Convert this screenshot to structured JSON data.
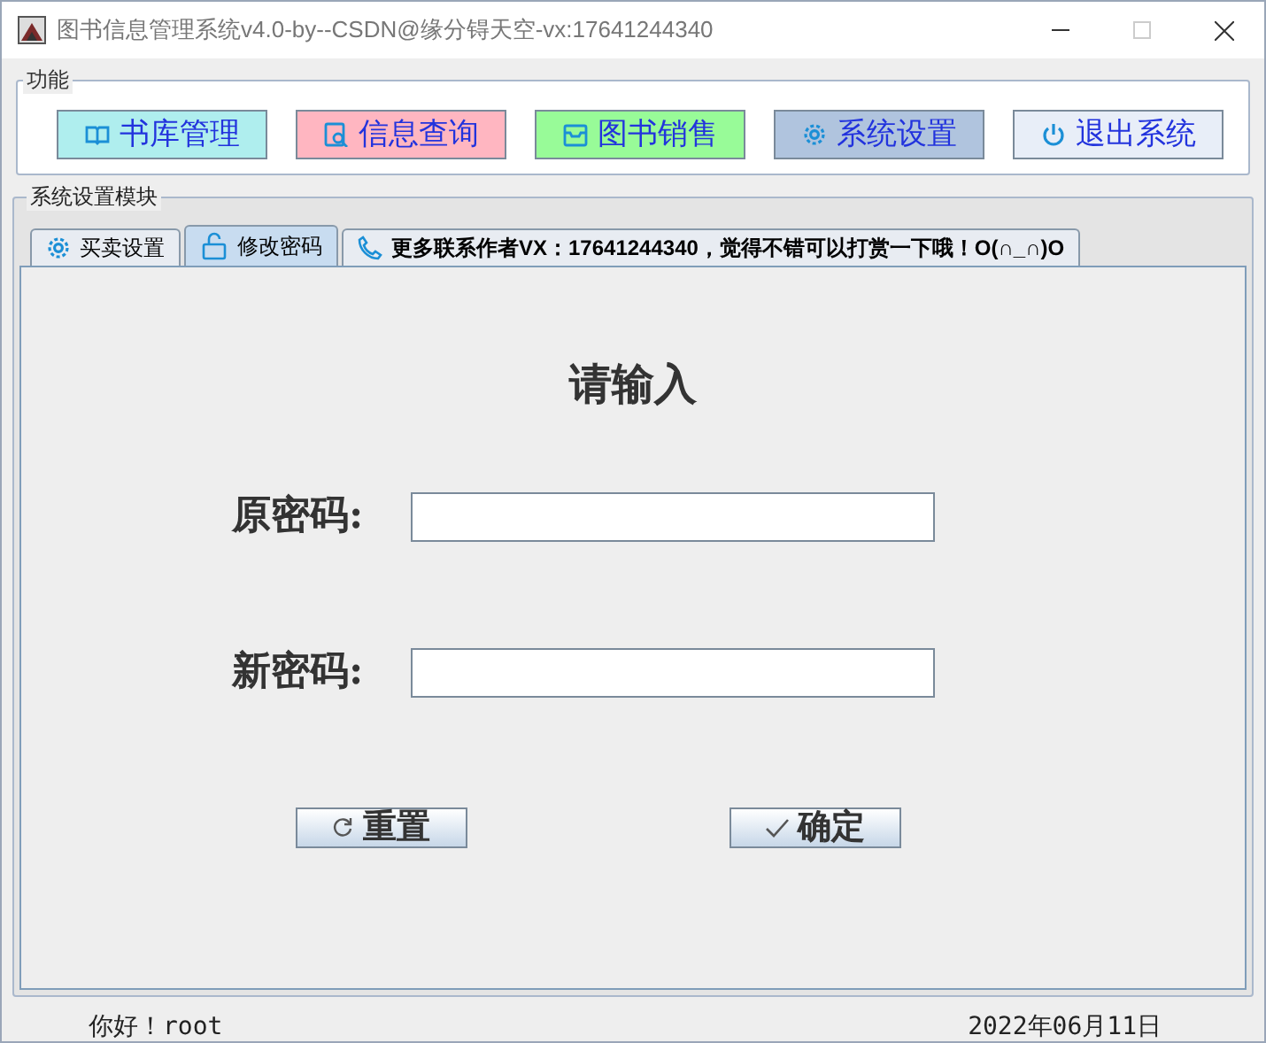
{
  "window": {
    "title": "图书信息管理系统v4.0-by--CSDN@缘分锝天空-vx:17641244340"
  },
  "function_panel": {
    "title": "功能",
    "buttons": [
      {
        "label": "书库管理",
        "kind": "book",
        "color": "#afeeee"
      },
      {
        "label": "信息查询",
        "kind": "search",
        "color": "#ffb6c1"
      },
      {
        "label": "图书销售",
        "kind": "tray",
        "color": "#98fb98"
      },
      {
        "label": "系统设置",
        "kind": "gear",
        "color": "#b0c4de"
      },
      {
        "label": "退出系统",
        "kind": "power",
        "color": "#e8eef8"
      }
    ]
  },
  "module_panel": {
    "title": "系统设置模块",
    "tabs": [
      {
        "label": "买卖设置",
        "kind": "gear",
        "selected": false
      },
      {
        "label": "修改密码",
        "kind": "lock",
        "selected": true
      },
      {
        "label": "更多联系作者VX：17641244340，觉得不错可以打赏一下哦！O(∩_∩)O",
        "kind": "phone",
        "selected": false
      }
    ],
    "heading": "请输入",
    "fields": [
      {
        "label": "原密码:"
      },
      {
        "label": "新密码:"
      }
    ],
    "actions": [
      {
        "label": "重置",
        "kind": "refresh"
      },
      {
        "label": "确定",
        "kind": "check"
      }
    ]
  },
  "status_bar": {
    "greeting": "你好！root",
    "date": "2022年06月11日"
  }
}
